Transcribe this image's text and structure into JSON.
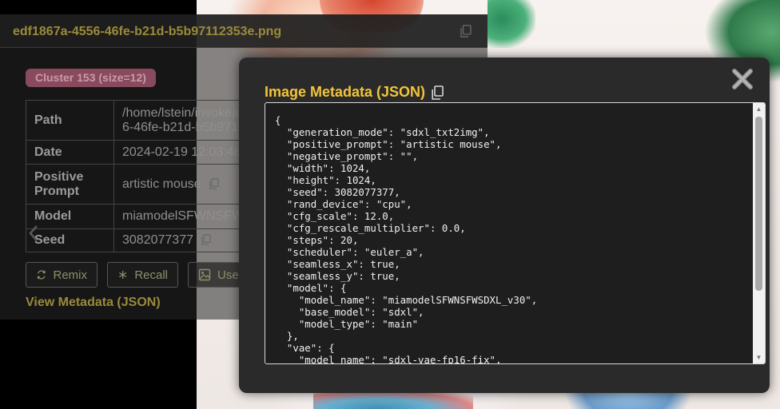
{
  "header": {
    "filename": "edf1867a-4556-46fe-b21d-b5b97112353e.png"
  },
  "cluster": {
    "label": "Cluster 153 (size=12)"
  },
  "metadata_table": {
    "rows": [
      {
        "key": "Path",
        "value_line1": "/home/lstein/invokea",
        "value_line2": "6-46fe-b21d-b5b971"
      },
      {
        "key": "Date",
        "value": "2024-02-19 12:03:48"
      },
      {
        "key_line1": "Positive",
        "key_line2": "Prompt",
        "value": "artistic mouse"
      },
      {
        "key": "Model",
        "value": "miamodelSFWNSFW"
      },
      {
        "key": "Seed",
        "value": "3082077377"
      }
    ]
  },
  "actions": {
    "remix": "Remix",
    "recall": "Recall",
    "use": "Use"
  },
  "view_metadata_link": "View Metadata (JSON)",
  "modal": {
    "title": "Image Metadata (JSON)",
    "json_text": "{\n  \"generation_mode\": \"sdxl_txt2img\",\n  \"positive_prompt\": \"artistic mouse\",\n  \"negative_prompt\": \"\",\n  \"width\": 1024,\n  \"height\": 1024,\n  \"seed\": 3082077377,\n  \"rand_device\": \"cpu\",\n  \"cfg_scale\": 12.0,\n  \"cfg_rescale_multiplier\": 0.0,\n  \"steps\": 20,\n  \"scheduler\": \"euler_a\",\n  \"seamless_x\": true,\n  \"seamless_y\": true,\n  \"model\": {\n    \"model_name\": \"miamodelSFWNSFWSDXL_v30\",\n    \"base_model\": \"sdxl\",\n    \"model_type\": \"main\"\n  },\n  \"vae\": {\n    \"model_name\": \"sdxl-vae-fp16-fix\","
  },
  "icons": {
    "copy": "copy-icon",
    "close": "close-icon",
    "remix": "refresh-icon",
    "recall": "asterisk-icon",
    "use": "image-icon",
    "prev": "chevron-left-icon"
  },
  "colors": {
    "modal_title": "#f2c43a",
    "link_gold": "#9a8b3a",
    "badge_bg": "#8a4a5e"
  }
}
